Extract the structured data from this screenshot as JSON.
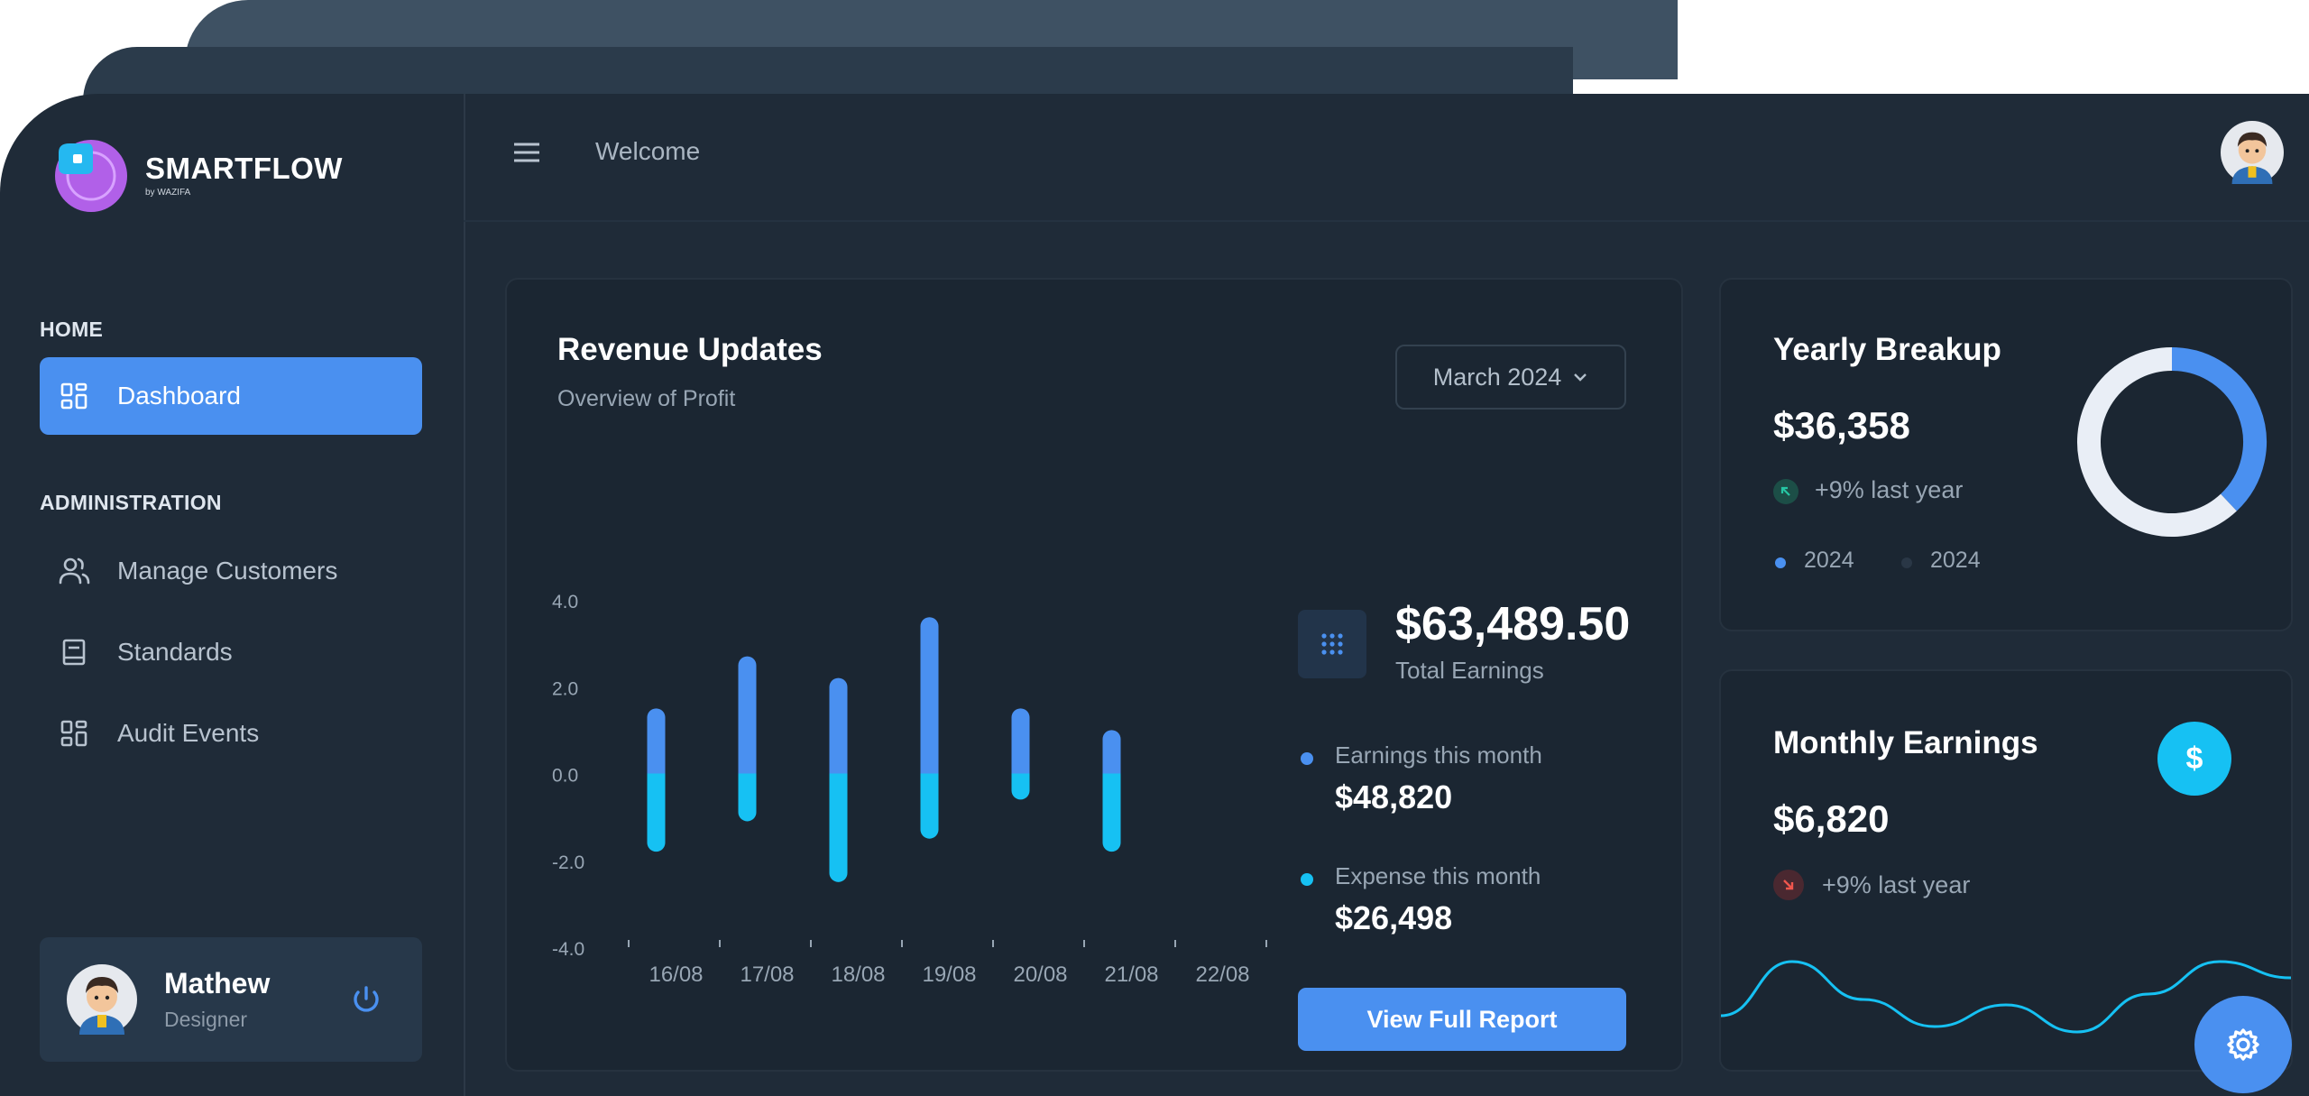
{
  "brand": {
    "name": "SMARTFLOW",
    "sub": "by WAZIFA"
  },
  "sidebar": {
    "home_label": "HOME",
    "admin_label": "ADMINISTRATION",
    "items": [
      {
        "label": "Dashboard",
        "icon": "dashboard-icon",
        "active": true
      },
      {
        "label": "Manage Customers",
        "icon": "users-icon",
        "active": false
      },
      {
        "label": "Standards",
        "icon": "book-icon",
        "active": false
      },
      {
        "label": "Audit Events",
        "icon": "grid-icon",
        "active": false
      }
    ]
  },
  "user": {
    "name": "Mathew",
    "role": "Designer"
  },
  "header": {
    "welcome": "Welcome"
  },
  "revenue": {
    "title": "Revenue Updates",
    "subtitle": "Overview of Profit",
    "period": "March 2024",
    "total": "$63,489.50",
    "total_label": "Total Earnings",
    "earnings_label": "Earnings this month",
    "earnings_value": "$48,820",
    "expense_label": "Expense this month",
    "expense_value": "$26,498",
    "button": "View Full Report"
  },
  "yearly": {
    "title": "Yearly Breakup",
    "value": "$36,358",
    "change": "+9% last year",
    "legend": [
      "2024",
      "2024"
    ]
  },
  "monthly": {
    "title": "Monthly Earnings",
    "value": "$6,820",
    "change": "+9% last year",
    "icon_symbol": "$"
  },
  "colors": {
    "accent": "#4a90f0",
    "earnings": "#4a90f0",
    "expense": "#16c1f3",
    "donut_light": "#e9eef6"
  },
  "chart_data": [
    {
      "type": "bar",
      "categories": [
        "16/08",
        "17/08",
        "18/08",
        "19/08",
        "20/08",
        "21/08",
        "22/08"
      ],
      "yticks": [
        "4.0",
        "2.0",
        "0.0",
        "-2.0",
        "-4.0"
      ],
      "ylim": [
        -4,
        4
      ],
      "series": [
        {
          "values": [
            1.5,
            2.7,
            2.2,
            3.6,
            1.5,
            1.0
          ],
          "color": "#4a90f0"
        },
        {
          "values": [
            -1.8,
            -1.1,
            -2.5,
            -1.5,
            -0.6,
            -1.8
          ],
          "color": "#16c1f3"
        }
      ]
    },
    {
      "type": "pie",
      "series": [
        {
          "values": [
            38,
            62
          ],
          "colors": [
            "#4a90f0",
            "#e9eef6"
          ]
        }
      ]
    },
    {
      "type": "line",
      "series": [
        {
          "values": [
            40,
            90,
            55,
            30,
            50,
            25,
            60,
            90,
            75
          ],
          "color": "#16c1f3"
        }
      ]
    }
  ]
}
